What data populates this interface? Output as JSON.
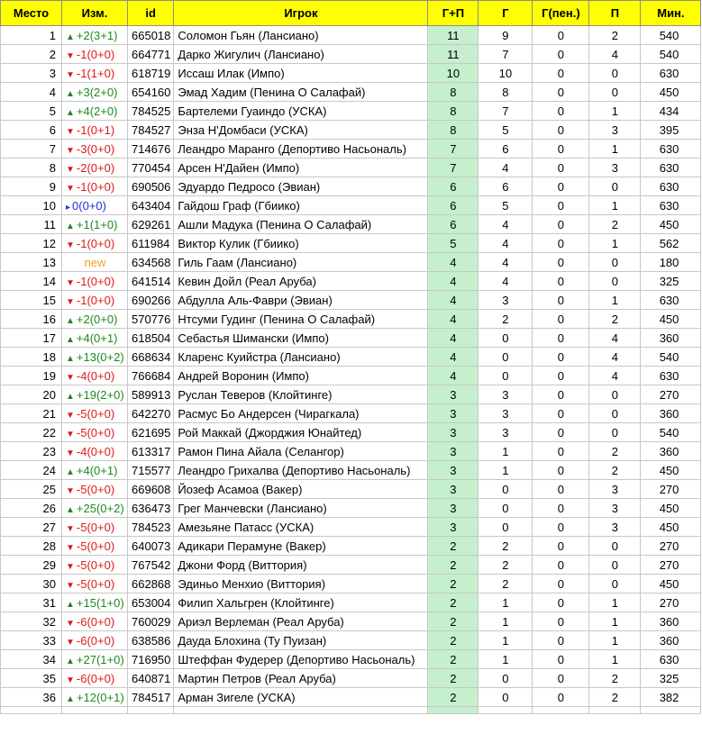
{
  "headers": {
    "place": "Место",
    "change": "Изм.",
    "id": "id",
    "player": "Игрок",
    "gp": "Г+П",
    "g": "Г",
    "gpen": "Г(пен.)",
    "p": "П",
    "min": "Мин."
  },
  "rows": [
    {
      "place": "1",
      "dir": "up",
      "change": "+2(3+1)",
      "id": "665018",
      "player": "Соломон Гьян (Лансиано)",
      "gp": "11",
      "g": "9",
      "gpen": "0",
      "p": "2",
      "min": "540"
    },
    {
      "place": "2",
      "dir": "down",
      "change": "-1(0+0)",
      "id": "664771",
      "player": "Дарко Жигулич (Лансиано)",
      "gp": "11",
      "g": "7",
      "gpen": "0",
      "p": "4",
      "min": "540"
    },
    {
      "place": "3",
      "dir": "down",
      "change": "-1(1+0)",
      "id": "618719",
      "player": "Иссаш Илак (Импо)",
      "gp": "10",
      "g": "10",
      "gpen": "0",
      "p": "0",
      "min": "630"
    },
    {
      "place": "4",
      "dir": "up",
      "change": "+3(2+0)",
      "id": "654160",
      "player": "Эмад Хадим (Пенина О Салафай)",
      "gp": "8",
      "g": "8",
      "gpen": "0",
      "p": "0",
      "min": "450"
    },
    {
      "place": "5",
      "dir": "up",
      "change": "+4(2+0)",
      "id": "784525",
      "player": "Бартелеми Гуаиндо (УСКА)",
      "gp": "8",
      "g": "7",
      "gpen": "0",
      "p": "1",
      "min": "434"
    },
    {
      "place": "6",
      "dir": "down",
      "change": "-1(0+1)",
      "id": "784527",
      "player": "Энза Н'Домбаси (УСКА)",
      "gp": "8",
      "g": "5",
      "gpen": "0",
      "p": "3",
      "min": "395"
    },
    {
      "place": "7",
      "dir": "down",
      "change": "-3(0+0)",
      "id": "714676",
      "player": "Леандро Маранго (Депортиво Насьональ)",
      "gp": "7",
      "g": "6",
      "gpen": "0",
      "p": "1",
      "min": "630"
    },
    {
      "place": "8",
      "dir": "down",
      "change": "-2(0+0)",
      "id": "770454",
      "player": "Арсен Н'Дайен (Импо)",
      "gp": "7",
      "g": "4",
      "gpen": "0",
      "p": "3",
      "min": "630"
    },
    {
      "place": "9",
      "dir": "down",
      "change": "-1(0+0)",
      "id": "690506",
      "player": "Эдуардо Педросо (Эвиан)",
      "gp": "6",
      "g": "6",
      "gpen": "0",
      "p": "0",
      "min": "630"
    },
    {
      "place": "10",
      "dir": "same",
      "change": "0(0+0)",
      "id": "643404",
      "player": "Гайдош Граф (Гбиико)",
      "gp": "6",
      "g": "5",
      "gpen": "0",
      "p": "1",
      "min": "630"
    },
    {
      "place": "11",
      "dir": "up",
      "change": "+1(1+0)",
      "id": "629261",
      "player": "Ашли Мадука (Пенина О Салафай)",
      "gp": "6",
      "g": "4",
      "gpen": "0",
      "p": "2",
      "min": "450"
    },
    {
      "place": "12",
      "dir": "down",
      "change": "-1(0+0)",
      "id": "611984",
      "player": "Виктор Кулик (Гбиико)",
      "gp": "5",
      "g": "4",
      "gpen": "0",
      "p": "1",
      "min": "562"
    },
    {
      "place": "13",
      "dir": "new",
      "change": "new",
      "id": "634568",
      "player": "Гиль Гаам (Лансиано)",
      "gp": "4",
      "g": "4",
      "gpen": "0",
      "p": "0",
      "min": "180"
    },
    {
      "place": "14",
      "dir": "down",
      "change": "-1(0+0)",
      "id": "641514",
      "player": "Кевин Дойл (Реал Аруба)",
      "gp": "4",
      "g": "4",
      "gpen": "0",
      "p": "0",
      "min": "325"
    },
    {
      "place": "15",
      "dir": "down",
      "change": "-1(0+0)",
      "id": "690266",
      "player": "Абдулла Аль-Фаври (Эвиан)",
      "gp": "4",
      "g": "3",
      "gpen": "0",
      "p": "1",
      "min": "630"
    },
    {
      "place": "16",
      "dir": "up",
      "change": "+2(0+0)",
      "id": "570776",
      "player": "Нтсуми Гудинг (Пенина О Салафай)",
      "gp": "4",
      "g": "2",
      "gpen": "0",
      "p": "2",
      "min": "450"
    },
    {
      "place": "17",
      "dir": "up",
      "change": "+4(0+1)",
      "id": "618504",
      "player": "Себастья Шимански (Импо)",
      "gp": "4",
      "g": "0",
      "gpen": "0",
      "p": "4",
      "min": "360"
    },
    {
      "place": "18",
      "dir": "up",
      "change": "+13(0+2)",
      "id": "668634",
      "player": "Кларенс Куийстра (Лансиано)",
      "gp": "4",
      "g": "0",
      "gpen": "0",
      "p": "4",
      "min": "540"
    },
    {
      "place": "19",
      "dir": "down",
      "change": "-4(0+0)",
      "id": "766684",
      "player": "Андрей Воронин (Импо)",
      "gp": "4",
      "g": "0",
      "gpen": "0",
      "p": "4",
      "min": "630"
    },
    {
      "place": "20",
      "dir": "up",
      "change": "+19(2+0)",
      "id": "589913",
      "player": "Руслан Теверов (Клойтинге)",
      "gp": "3",
      "g": "3",
      "gpen": "0",
      "p": "0",
      "min": "270"
    },
    {
      "place": "21",
      "dir": "down",
      "change": "-5(0+0)",
      "id": "642270",
      "player": "Расмус Бо Андерсен (Чирагкала)",
      "gp": "3",
      "g": "3",
      "gpen": "0",
      "p": "0",
      "min": "360"
    },
    {
      "place": "22",
      "dir": "down",
      "change": "-5(0+0)",
      "id": "621695",
      "player": "Рой Маккай (Джорджия Юнайтед)",
      "gp": "3",
      "g": "3",
      "gpen": "0",
      "p": "0",
      "min": "540"
    },
    {
      "place": "23",
      "dir": "down",
      "change": "-4(0+0)",
      "id": "613317",
      "player": "Рамон Пина Айала (Селангор)",
      "gp": "3",
      "g": "1",
      "gpen": "0",
      "p": "2",
      "min": "360"
    },
    {
      "place": "24",
      "dir": "up",
      "change": "+4(0+1)",
      "id": "715577",
      "player": "Леандро Грихалва (Депортиво Насьональ)",
      "gp": "3",
      "g": "1",
      "gpen": "0",
      "p": "2",
      "min": "450"
    },
    {
      "place": "25",
      "dir": "down",
      "change": "-5(0+0)",
      "id": "669608",
      "player": "Йозеф Асамоа (Вакер)",
      "gp": "3",
      "g": "0",
      "gpen": "0",
      "p": "3",
      "min": "270"
    },
    {
      "place": "26",
      "dir": "up",
      "change": "+25(0+2)",
      "id": "636473",
      "player": "Грег Манчевски (Лансиано)",
      "gp": "3",
      "g": "0",
      "gpen": "0",
      "p": "3",
      "min": "450"
    },
    {
      "place": "27",
      "dir": "down",
      "change": "-5(0+0)",
      "id": "784523",
      "player": "Амезьяне Патасс (УСКА)",
      "gp": "3",
      "g": "0",
      "gpen": "0",
      "p": "3",
      "min": "450"
    },
    {
      "place": "28",
      "dir": "down",
      "change": "-5(0+0)",
      "id": "640073",
      "player": "Адикари Перамуне (Вакер)",
      "gp": "2",
      "g": "2",
      "gpen": "0",
      "p": "0",
      "min": "270"
    },
    {
      "place": "29",
      "dir": "down",
      "change": "-5(0+0)",
      "id": "767542",
      "player": "Джони Форд (Виттория)",
      "gp": "2",
      "g": "2",
      "gpen": "0",
      "p": "0",
      "min": "270"
    },
    {
      "place": "30",
      "dir": "down",
      "change": "-5(0+0)",
      "id": "662868",
      "player": "Эдиньо Менхио (Виттория)",
      "gp": "2",
      "g": "2",
      "gpen": "0",
      "p": "0",
      "min": "450"
    },
    {
      "place": "31",
      "dir": "up",
      "change": "+15(1+0)",
      "id": "653004",
      "player": "Филип Хальгрен (Клойтинге)",
      "gp": "2",
      "g": "1",
      "gpen": "0",
      "p": "1",
      "min": "270"
    },
    {
      "place": "32",
      "dir": "down",
      "change": "-6(0+0)",
      "id": "760029",
      "player": "Ариэл Верлеман (Реал Аруба)",
      "gp": "2",
      "g": "1",
      "gpen": "0",
      "p": "1",
      "min": "360"
    },
    {
      "place": "33",
      "dir": "down",
      "change": "-6(0+0)",
      "id": "638586",
      "player": "Дауда Блохина (Ту Пуизан)",
      "gp": "2",
      "g": "1",
      "gpen": "0",
      "p": "1",
      "min": "360"
    },
    {
      "place": "34",
      "dir": "up",
      "change": "+27(1+0)",
      "id": "716950",
      "player": "Штеффан Фудерер (Депортиво Насьональ)",
      "gp": "2",
      "g": "1",
      "gpen": "0",
      "p": "1",
      "min": "630"
    },
    {
      "place": "35",
      "dir": "down",
      "change": "-6(0+0)",
      "id": "640871",
      "player": "Мартин Петров (Реал Аруба)",
      "gp": "2",
      "g": "0",
      "gpen": "0",
      "p": "2",
      "min": "325"
    },
    {
      "place": "36",
      "dir": "up",
      "change": "+12(0+1)",
      "id": "784517",
      "player": "Арман Зигеле (УСКА)",
      "gp": "2",
      "g": "0",
      "gpen": "0",
      "p": "2",
      "min": "382"
    }
  ]
}
